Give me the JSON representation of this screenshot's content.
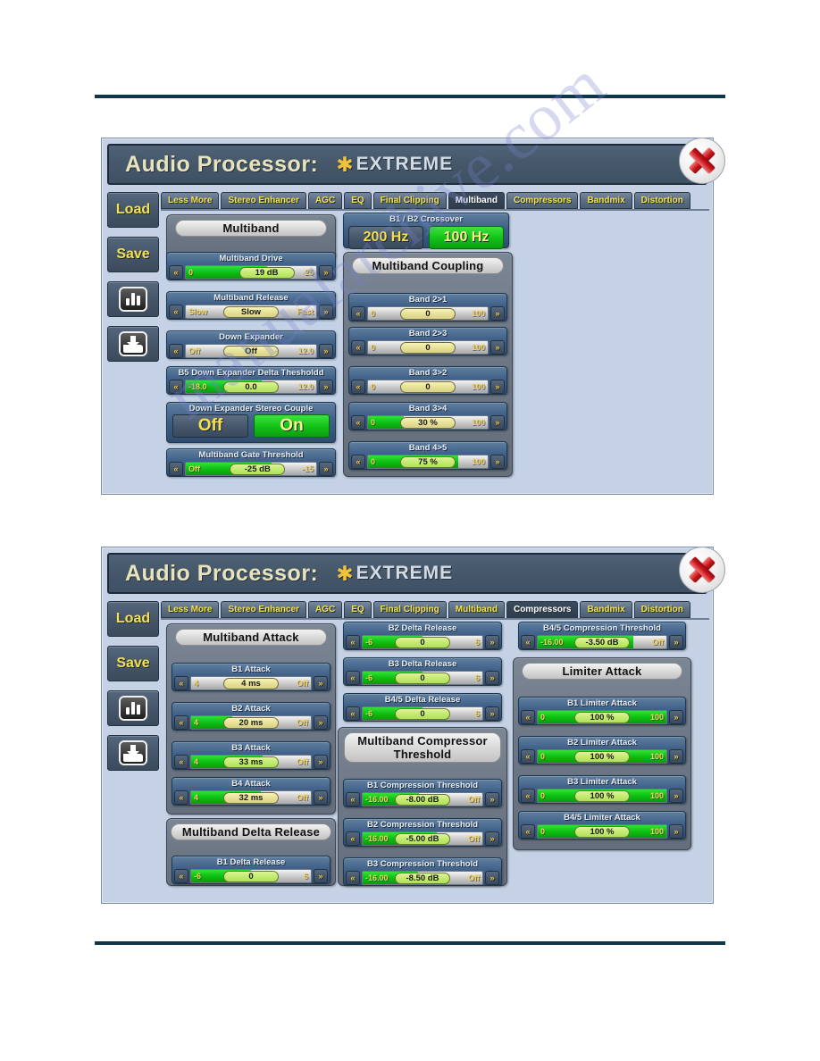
{
  "watermark": "manualarchive.com",
  "window": {
    "title_main": "Audio Processor:",
    "title_star": "✱",
    "title_sub": "EXTREME",
    "close_label": "×"
  },
  "sidebar": {
    "load_label": "Load",
    "save_label": "Save",
    "chart_icon": "bar-chart-icon",
    "save_file_icon": "save-to-folder-icon"
  },
  "tabs": [
    "Less More",
    "Stereo Enhancer",
    "AGC",
    "EQ",
    "Final Clipping",
    "Multiband",
    "Compressors",
    "Bandmix",
    "Distortion"
  ],
  "screen1": {
    "active_tab": "Multiband",
    "left_group_title": "Multiband",
    "crossover": {
      "label": "B1 / B2 Crossover",
      "options": [
        {
          "label": "200 Hz",
          "selected": false
        },
        {
          "label": "100 Hz",
          "selected": true
        }
      ]
    },
    "coupling_group_title": "Multiband Coupling",
    "left_controls": [
      {
        "label": "Multiband Drive",
        "min": "0",
        "max": "25",
        "value": "19 dB",
        "fill_pct": 62,
        "thumb_pct": 62,
        "thumb_green": true
      },
      {
        "label": "Multiband Release",
        "min": "Slow",
        "max": "Fast",
        "value": "Slow",
        "fill_pct": 0,
        "thumb_pct": 50,
        "thumb_green": false
      },
      {
        "label": "Down Expander",
        "min": "Off",
        "max": "12.0",
        "value": "Off",
        "fill_pct": 0,
        "thumb_pct": 50,
        "thumb_green": false
      },
      {
        "label": "B5 Down Expander Delta Thesholdd",
        "min": "-18.0",
        "max": "12.0",
        "value": "0.0",
        "fill_pct": 58,
        "thumb_pct": 50,
        "thumb_green": true
      }
    ],
    "stereo_couple": {
      "label": "Down Expander Stereo Couple",
      "off_label": "Off",
      "on_label": "On",
      "selected": "On"
    },
    "gate": {
      "label": "Multiband Gate Threshold",
      "min": "Off",
      "max": "-15",
      "value": "-25 dB",
      "fill_pct": 66,
      "thumb_pct": 55,
      "thumb_green": true
    },
    "coupling_controls": [
      {
        "label": "Band 2>1",
        "min": "0",
        "max": "100",
        "value": "0",
        "fill_pct": 0,
        "thumb_pct": 50,
        "thumb_green": false
      },
      {
        "label": "Band 2>3",
        "min": "0",
        "max": "100",
        "value": "0",
        "fill_pct": 0,
        "thumb_pct": 50,
        "thumb_green": false
      },
      {
        "label": "Band 3>2",
        "min": "0",
        "max": "100",
        "value": "0",
        "fill_pct": 0,
        "thumb_pct": 50,
        "thumb_green": false
      },
      {
        "label": "Band 3>4",
        "min": "0",
        "max": "100",
        "value": "30 %",
        "fill_pct": 30,
        "thumb_pct": 50,
        "thumb_green": false
      },
      {
        "label": "Band 4>5",
        "min": "0",
        "max": "100",
        "value": "75 %",
        "fill_pct": 75,
        "thumb_pct": 50,
        "thumb_green": true
      }
    ]
  },
  "screen2": {
    "active_tab": "Compressors",
    "attack_group_title": "Multiband Attack",
    "delta_group_title": "Multiband Delta Release",
    "comp_group_title_l1": "Multiband Compressor",
    "comp_group_title_l2": "Threshold",
    "limiter_group_title": "Limiter Attack",
    "attack_controls": [
      {
        "label": "B1 Attack",
        "min": "4",
        "max": "Off",
        "value": "4 ms",
        "fill_pct": 0,
        "thumb_pct": 50,
        "thumb_green": false
      },
      {
        "label": "B2 Attack",
        "min": "4",
        "max": "Off",
        "value": "20 ms",
        "fill_pct": 34,
        "thumb_pct": 50,
        "thumb_green": false
      },
      {
        "label": "B3 Attack",
        "min": "4",
        "max": "Off",
        "value": "33 ms",
        "fill_pct": 60,
        "thumb_pct": 50,
        "thumb_green": true
      },
      {
        "label": "B4 Attack",
        "min": "4",
        "max": "Off",
        "value": "32 ms",
        "fill_pct": 58,
        "thumb_pct": 50,
        "thumb_green": false
      }
    ],
    "delta_controls": [
      {
        "label": "B1 Delta Release",
        "min": "-6",
        "max": "6",
        "value": "0",
        "fill_pct": 50,
        "thumb_pct": 50,
        "thumb_green": true
      },
      {
        "label": "B2 Delta Release",
        "min": "-6",
        "max": "6",
        "value": "0",
        "fill_pct": 50,
        "thumb_pct": 50,
        "thumb_green": true
      },
      {
        "label": "B3 Delta Release",
        "min": "-6",
        "max": "6",
        "value": "0",
        "fill_pct": 50,
        "thumb_pct": 50,
        "thumb_green": true
      },
      {
        "label": "B4/5 Delta Release",
        "min": "-6",
        "max": "6",
        "value": "0",
        "fill_pct": 50,
        "thumb_pct": 50,
        "thumb_green": true
      }
    ],
    "comp_controls": [
      {
        "label": "B1 Compression Threshold",
        "min": "-16.00",
        "max": "Off",
        "value": "-8.00 dB",
        "fill_pct": 47,
        "thumb_pct": 50,
        "thumb_green": true
      },
      {
        "label": "B2 Compression Threshold",
        "min": "-16.00",
        "max": "Off",
        "value": "-5.00 dB",
        "fill_pct": 62,
        "thumb_pct": 50,
        "thumb_green": true
      },
      {
        "label": "B3 Compression Threshold",
        "min": "-16.00",
        "max": "Off",
        "value": "-8.50 dB",
        "fill_pct": 46,
        "thumb_pct": 50,
        "thumb_green": true
      }
    ],
    "comp45": {
      "label": "B4/5 Compression Threshold",
      "min": "-16.00",
      "max": "Off",
      "value": "-3.50 dB",
      "fill_pct": 74,
      "thumb_pct": 50,
      "thumb_green": true
    },
    "limiter_controls": [
      {
        "label": "B1 Limiter Attack",
        "min": "0",
        "max": "100",
        "value": "100 %",
        "fill_pct": 100,
        "thumb_pct": 50,
        "thumb_green": true
      },
      {
        "label": "B2 Limiter Attack",
        "min": "0",
        "max": "100",
        "value": "100 %",
        "fill_pct": 100,
        "thumb_pct": 50,
        "thumb_green": true
      },
      {
        "label": "B3 Limiter Attack",
        "min": "0",
        "max": "100",
        "value": "100 %",
        "fill_pct": 100,
        "thumb_pct": 50,
        "thumb_green": true
      },
      {
        "label": "B4/5 Limiter Attack",
        "min": "0",
        "max": "100",
        "value": "100 %",
        "fill_pct": 100,
        "thumb_pct": 50,
        "thumb_green": true
      }
    ]
  },
  "icons": {
    "prev": "«",
    "next": "»"
  }
}
